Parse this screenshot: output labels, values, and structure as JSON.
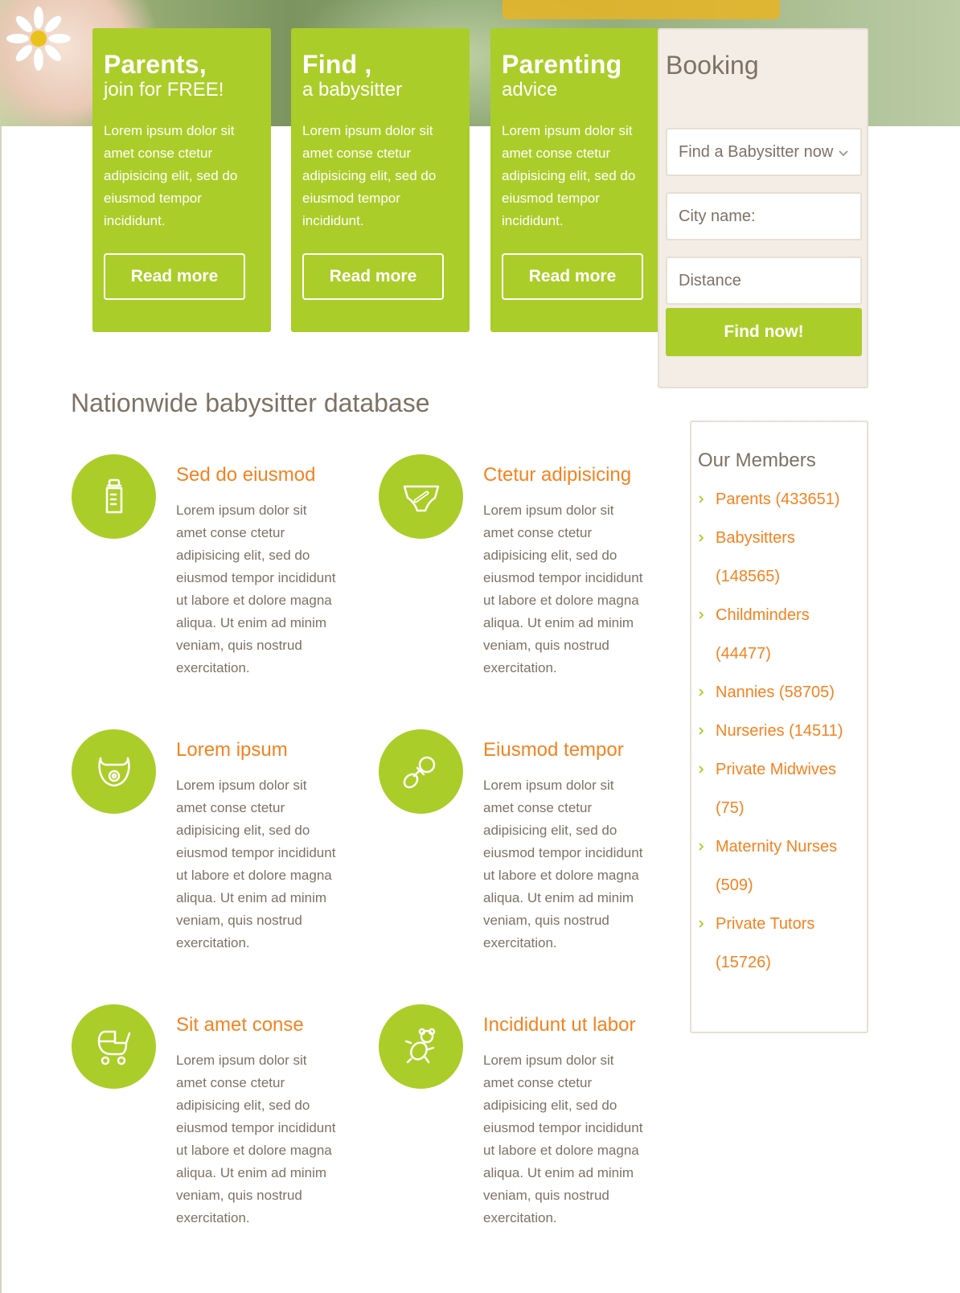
{
  "colors": {
    "accent": "#abcd29",
    "link": "#f5821f",
    "text": "#7d7264",
    "panel": "#f3ede6"
  },
  "cards": [
    {
      "title": "Parents,",
      "subtitle": "join for FREE!",
      "text": "Lorem ipsum dolor sit amet conse ctetur adipisicing elit, sed do eiusmod tempor incididunt.",
      "button": "Read more"
    },
    {
      "title": "Find ,",
      "subtitle": "a babysitter",
      "text": "Lorem ipsum dolor sit amet conse ctetur adipisicing elit, sed do eiusmod tempor incididunt.",
      "button": "Read more"
    },
    {
      "title": "Parenting",
      "subtitle": "advice",
      "text": "Lorem ipsum dolor sit amet conse ctetur adipisicing elit, sed do eiusmod tempor incididunt.",
      "button": "Read more"
    }
  ],
  "booking": {
    "title": "Booking",
    "select_value": "Find a Babysitter now",
    "city_placeholder": "City name:",
    "distance_placeholder": "Distance",
    "button": "Find now!"
  },
  "section": {
    "title": "Nationwide babysitter database"
  },
  "features": [
    {
      "title": "Sed do eiusmod",
      "icon": "bottle-icon",
      "text": "Lorem ipsum dolor sit amet conse ctetur adipisicing elit, sed do eiusmod tempor incididunt ut labore et dolore magna aliqua. Ut enim ad minim veniam, quis nostrud exercitation."
    },
    {
      "title": "Ctetur adipisicing",
      "icon": "diaper-icon",
      "text": "Lorem ipsum dolor sit amet conse ctetur adipisicing elit, sed do eiusmod tempor incididunt ut labore et dolore magna aliqua. Ut enim ad minim veniam, quis nostrud exercitation."
    },
    {
      "title": "Lorem ipsum",
      "icon": "bib-icon",
      "text": "Lorem ipsum dolor sit amet conse ctetur adipisicing elit, sed do eiusmod tempor incididunt ut labore et dolore magna aliqua. Ut enim ad minim veniam, quis nostrud exercitation."
    },
    {
      "title": "Eiusmod tempor",
      "icon": "pacifier-icon",
      "text": "Lorem ipsum dolor sit amet conse ctetur adipisicing elit, sed do eiusmod tempor incididunt ut labore et dolore magna aliqua. Ut enim ad minim veniam, quis nostrud exercitation."
    },
    {
      "title": "Sit amet conse",
      "icon": "stroller-icon",
      "text": "Lorem ipsum dolor sit amet conse ctetur adipisicing elit, sed do eiusmod tempor incididunt ut labore et dolore magna aliqua. Ut enim ad minim veniam, quis nostrud exercitation."
    },
    {
      "title": "Incididunt ut labor",
      "icon": "teddy-icon",
      "text": "Lorem ipsum dolor sit amet conse ctetur adipisicing elit, sed do eiusmod tempor incididunt ut labore et dolore magna aliqua. Ut enim ad minim veniam, quis nostrud exercitation."
    }
  ],
  "members": {
    "title": "Our Members",
    "items": [
      "Parents (433651)",
      "Babysitters (148565)",
      "Childminders (44477)",
      "Nannies (58705)",
      "Nurseries (14511)",
      "Private Midwives (75)",
      "Maternity Nurses (509)",
      "Private Tutors (15726)"
    ]
  }
}
